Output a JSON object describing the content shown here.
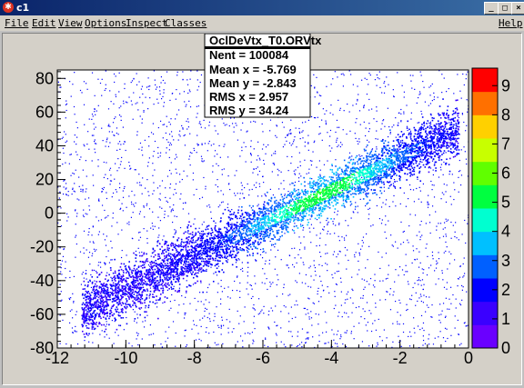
{
  "window": {
    "title": "c1",
    "icon": "root-icon"
  },
  "menu": {
    "file": "File",
    "edit": "Edit",
    "view": "View",
    "options": "Options",
    "inspect": "Inspect",
    "classes": "Classes",
    "help": "Help"
  },
  "stats": {
    "name": "OclDeVtx_T0.ORVtx",
    "entries": "Nent = 100084",
    "mean_x": "Mean x = -5.769",
    "mean_y": "Mean y = -2.843",
    "rms_x": "RMS x  =  2.957",
    "rms_y": "RMS y  =  34.24"
  },
  "chart_data": {
    "type": "heatmap",
    "title": "",
    "xlabel": "",
    "ylabel": "",
    "xlim": [
      -12,
      0
    ],
    "ylim": [
      -80,
      85
    ],
    "x_ticks": [
      "-12",
      "-10",
      "-8",
      "-6",
      "-4",
      "-2",
      "0"
    ],
    "y_ticks": [
      "-80",
      "-60",
      "-40",
      "-20",
      "0",
      "20",
      "40",
      "60",
      "80"
    ],
    "colorbar": {
      "min": 0,
      "max": 9.6,
      "ticks": [
        "0",
        "1",
        "2",
        "3",
        "4",
        "5",
        "6",
        "7",
        "8",
        "9"
      ],
      "colors": [
        "#6a00ff",
        "#3a00ff",
        "#0000ff",
        "#0060ff",
        "#00c0ff",
        "#00ffd0",
        "#00ff40",
        "#60ff00",
        "#c8ff00",
        "#ffd000",
        "#ff7000",
        "#ff0000"
      ]
    },
    "trend": {
      "slope": 9.73,
      "intercept": 53.0,
      "x_from": -11.3,
      "x_to": -0.3
    }
  }
}
